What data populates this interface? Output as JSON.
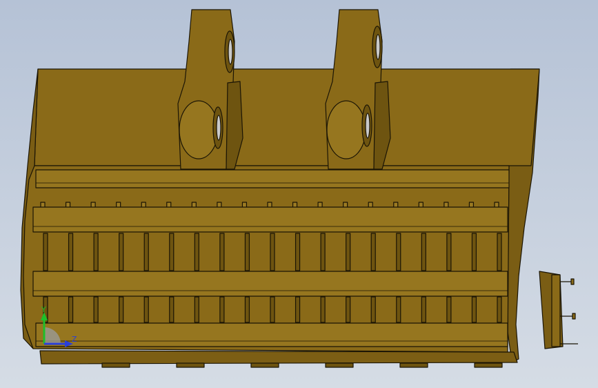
{
  "viewport": {
    "background_top": "#b5c2d6",
    "background_bottom": "#d5dce5"
  },
  "model": {
    "body_color": "#8a6a18",
    "body_dark": "#6e5410",
    "body_light": "#9c7b22",
    "edge_color": "#1a1405",
    "pin_color": "#c9c9c9",
    "rib_count": 19,
    "vertical_bar_count": 19
  },
  "triad": {
    "y_label": "Y",
    "z_label": "Z",
    "y_color": "#1fbf2a",
    "z_color": "#2a3fd8"
  }
}
